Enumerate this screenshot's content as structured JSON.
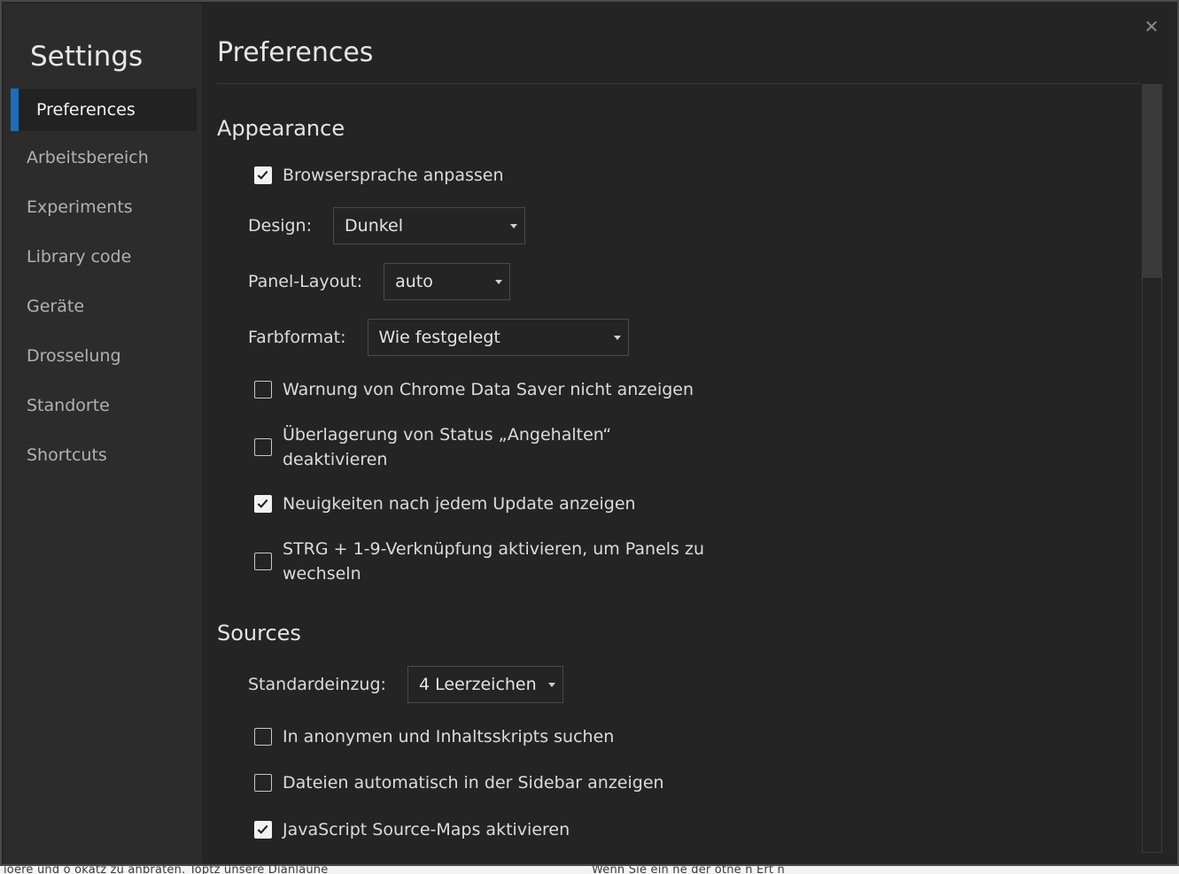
{
  "background_text": {
    "left": "ioere und o okatz zu anbraten. Toptz unsere Dianlaune",
    "right": "Wenn Sie ein    ne der   ötne n Ert   n"
  },
  "sidebar": {
    "title": "Settings",
    "items": [
      {
        "label": "Preferences",
        "selected": true
      },
      {
        "label": "Arbeitsbereich"
      },
      {
        "label": "Experiments"
      },
      {
        "label": "Library code"
      },
      {
        "label": "Geräte"
      },
      {
        "label": "Drosselung"
      },
      {
        "label": "Standorte"
      },
      {
        "label": "Shortcuts"
      }
    ]
  },
  "close_icon": "close-icon",
  "main": {
    "title": "Preferences",
    "sections": {
      "appearance": {
        "heading": "Appearance",
        "browser_language": {
          "label": "Browsersprache anpassen",
          "checked": true
        },
        "design": {
          "label": "Design:",
          "value": "Dunkel"
        },
        "panel_layout": {
          "label": "Panel-Layout:",
          "value": "auto"
        },
        "color_format": {
          "label": "Farbformat:",
          "value": "Wie festgelegt"
        },
        "data_saver_warning": {
          "label": "Warnung von Chrome Data Saver nicht anzeigen",
          "checked": false
        },
        "paused_overlay": {
          "label": "Überlagerung von Status „Angehalten“ deaktivieren",
          "checked": false
        },
        "whats_new": {
          "label": "Neuigkeiten nach jedem Update anzeigen",
          "checked": true
        },
        "ctrl_shortcut": {
          "label": "STRG + 1-9-Verknüpfung aktivieren, um Panels zu wechseln",
          "checked": false
        }
      },
      "sources": {
        "heading": "Sources",
        "default_indent": {
          "label": "Standardeinzug:",
          "value": "4 Leerzeichen"
        },
        "search_anonymous": {
          "label": "In anonymen und Inhaltsskripts suchen",
          "checked": false
        },
        "auto_reveal": {
          "label": "Dateien automatisch in der Sidebar anzeigen",
          "checked": false
        },
        "source_maps": {
          "label": "JavaScript Source-Maps aktivieren",
          "checked": true
        }
      }
    }
  },
  "colors": {
    "accent": "#1e6dbb",
    "sidebar_bg": "#2c2c2c",
    "content_bg": "#242424"
  }
}
